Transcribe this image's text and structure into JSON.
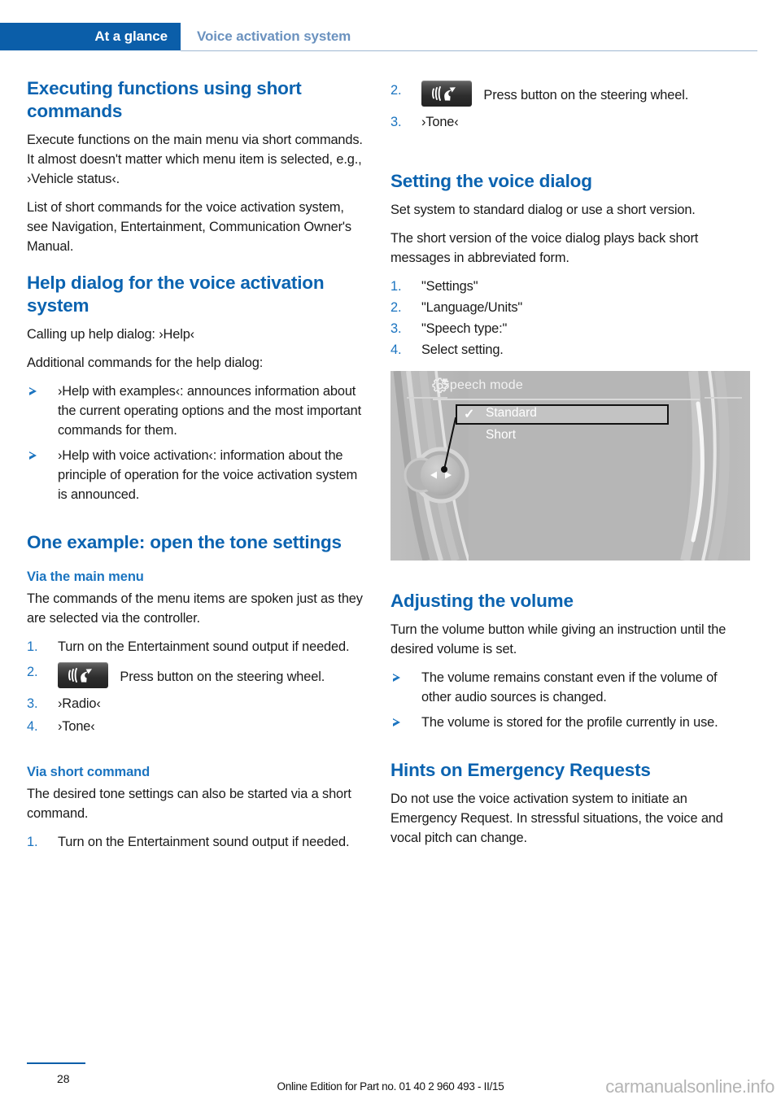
{
  "header": {
    "tab_label": "At a glance",
    "section_label": "Voice activation system",
    "tab_bg": "#0b5ea9",
    "section_color": "#6b92bf"
  },
  "left_column": {
    "heading_1": "Executing functions using short commands",
    "para_1": "Execute functions on the main menu via short commands. It almost doesn't matter which menu item is selected, e.g., ›Vehicle status‹.",
    "para_2": "List of short commands for the voice activation system, see Navigation, Entertainment, Communication Owner's Manual.",
    "heading_2": "Help dialog for the voice activation system",
    "para_3": "Calling up help dialog: ›Help‹",
    "para_4": "Additional commands for the help dialog:",
    "bullets": [
      "›Help with examples‹: announces information about the current operating options and the most important commands for them.",
      "›Help with voice activation‹: information about the principle of operation for the voice activation system is announced."
    ],
    "heading_3": "One example: open the tone settings",
    "subheading_1": "Via the main menu",
    "para_5": "The commands of the menu items are spoken just as they are selected via the controller.",
    "steps_main": [
      {
        "num": "1.",
        "text": "Turn on the Entertainment sound output if needed.",
        "icon": null
      },
      {
        "num": "2.",
        "text": "Press button on the steering wheel.",
        "icon": "speech-button-icon"
      },
      {
        "num": "3.",
        "text": "›Radio‹",
        "icon": null
      },
      {
        "num": "4.",
        "text": "›Tone‹",
        "icon": null
      }
    ],
    "subheading_2": "Via short command",
    "para_6": "The desired tone settings can also be started via a short command.",
    "steps_short": [
      {
        "num": "1.",
        "text": "Turn on the Entertainment sound output if needed.",
        "icon": null
      }
    ]
  },
  "right_column": {
    "steps_short_cont": [
      {
        "num": "2.",
        "text": "Press button on the steering wheel.",
        "icon": "speech-button-icon"
      },
      {
        "num": "3.",
        "text": "›Tone‹",
        "icon": null
      }
    ],
    "heading_1": "Setting the voice dialog",
    "para_1": "Set system to standard dialog or use a short version.",
    "para_2": "The short version of the voice dialog plays back short messages in abbreviated form.",
    "steps": [
      {
        "num": "1.",
        "text": "\"Settings\""
      },
      {
        "num": "2.",
        "text": "\"Language/Units\""
      },
      {
        "num": "3.",
        "text": "\"Speech type:\""
      },
      {
        "num": "4.",
        "text": "Select setting."
      }
    ],
    "figure": {
      "title": "Speech mode",
      "title_icon": "gear-settings-icon",
      "items": [
        {
          "label": "Standard",
          "checked": true
        },
        {
          "label": "Short",
          "checked": false
        }
      ],
      "callout_target": "controller-knob"
    },
    "heading_2": "Adjusting the volume",
    "para_3": "Turn the volume button while giving an instruction until the desired volume is set.",
    "bullets": [
      "The volume remains constant even if the volume of other audio sources is changed.",
      "The volume is stored for the profile currently in use."
    ],
    "heading_3": "Hints on Emergency Requests",
    "para_4": "Do not use the voice activation system to initiate an Emergency Request. In stressful situations, the voice and vocal pitch can change."
  },
  "footer": {
    "page_number": "28",
    "center_text": "Online Edition for Part no. 01 40 2 960 493 - II/15",
    "watermark": "carmanualsonline.info"
  }
}
